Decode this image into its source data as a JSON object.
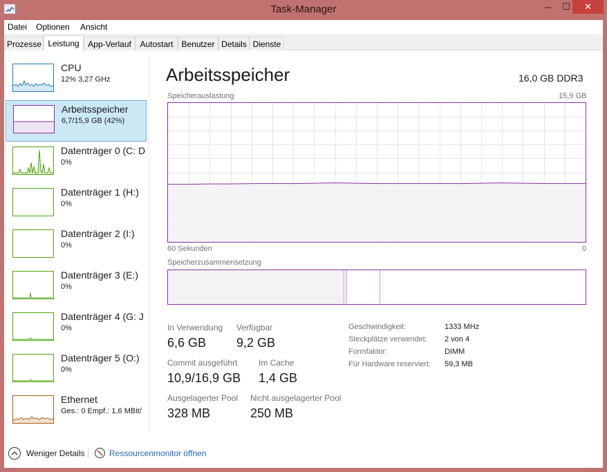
{
  "window": {
    "title": "Task-Manager",
    "minimize": "─",
    "maximize": "☐",
    "close": "✕"
  },
  "menu": [
    "Datei",
    "Optionen",
    "Ansicht"
  ],
  "tabs": [
    "Prozesse",
    "Leistung",
    "App-Verlauf",
    "Autostart",
    "Benutzer",
    "Details",
    "Dienste"
  ],
  "active_tab": "Leistung",
  "sidebar": [
    {
      "name": "CPU",
      "sub": "12% 3,27 GHz",
      "color": "#1779ba",
      "icon": "cpu-graph"
    },
    {
      "name": "Arbeitsspeicher",
      "sub": "6,7/15,9 GB (42%)",
      "color": "#8b2fa7",
      "icon": "memory-graph",
      "selected": true
    },
    {
      "name": "Datenträger 0 (C: D",
      "sub": "0%",
      "color": "#4da60c",
      "icon": "disk-graph"
    },
    {
      "name": "Datenträger 1 (H:)",
      "sub": "0%",
      "color": "#4da60c",
      "icon": "disk-graph"
    },
    {
      "name": "Datenträger 2 (I:)",
      "sub": "0%",
      "color": "#4da60c",
      "icon": "disk-graph"
    },
    {
      "name": "Datenträger 3 (E:)",
      "sub": "0%",
      "color": "#4da60c",
      "icon": "disk-graph"
    },
    {
      "name": "Datenträger 4 (G: J",
      "sub": "0%",
      "color": "#4da60c",
      "icon": "disk-graph"
    },
    {
      "name": "Datenträger 5 (O:)",
      "sub": "0%",
      "color": "#4da60c",
      "icon": "disk-graph"
    },
    {
      "name": "Ethernet",
      "sub": "Ges.: 0 Empf.: 1,6 MBit/",
      "color": "#a75a14",
      "icon": "network-graph"
    }
  ],
  "main": {
    "title": "Arbeitsspeicher",
    "subtitle": "16,0 GB DDR3",
    "graph": {
      "label": "Speicherauslastung",
      "max_label": "15,9 GB",
      "time_left": "60 Sekunden",
      "time_right": "0",
      "usage_fraction": 0.42
    },
    "composition": {
      "label": "Speicherzusammensetzung",
      "in_use_fraction": 0.42,
      "modified_fraction": 0.005,
      "standby_fraction": 0.08
    },
    "stats": [
      {
        "label": "In Verwendung",
        "value": "6,6 GB"
      },
      {
        "label": "Verfügbar",
        "value": "9,2 GB"
      },
      {
        "label": "Commit ausgeführt",
        "value": "10,9/16,9 GB"
      },
      {
        "label": "Im Cache",
        "value": "1,4 GB"
      },
      {
        "label": "Ausgelagerter Pool",
        "value": "328 MB"
      },
      {
        "label": "Nicht ausgelagerter Pool",
        "value": "250 MB"
      }
    ],
    "info": [
      {
        "label": "Geschwindigkeit:",
        "value": "1333 MHz"
      },
      {
        "label": "Steckplätze verwendet:",
        "value": "2 von 4"
      },
      {
        "label": "Formfaktor:",
        "value": "DIMM"
      },
      {
        "label": "Für Hardware reserviert:",
        "value": "59,3 MB"
      }
    ]
  },
  "footer": {
    "fewer_details": "Weniger Details",
    "resource_monitor": "Ressourcenmonitor öffnen"
  },
  "colors": {
    "memory": "#8b2fa7",
    "memory_fill": "#f4f2f4",
    "grid": "#e6e6e6",
    "link": "#1e66b4",
    "selection": "#cce8f5"
  }
}
